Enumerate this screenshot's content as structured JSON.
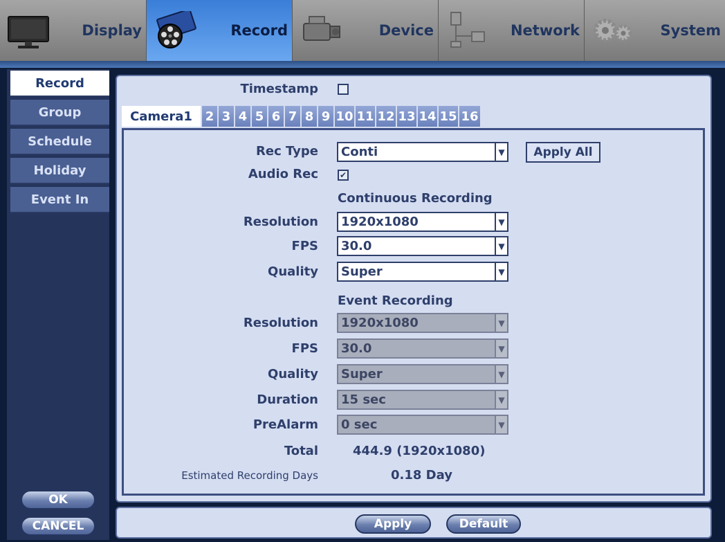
{
  "menu": {
    "tabs": [
      {
        "label": "Display",
        "icon": "monitor-icon"
      },
      {
        "label": "Record",
        "icon": "film-reel-icon"
      },
      {
        "label": "Device",
        "icon": "camera-icon"
      },
      {
        "label": "Network",
        "icon": "network-icon"
      },
      {
        "label": "System",
        "icon": "gear-icon"
      }
    ],
    "active": "Record"
  },
  "sidebar": {
    "items": [
      "Record",
      "Group",
      "Schedule",
      "Holiday",
      "Event In"
    ],
    "active": "Record",
    "ok_label": "OK",
    "cancel_label": "CANCEL"
  },
  "timestamp": {
    "label": "Timestamp",
    "checked": false
  },
  "camera_tabs": [
    "Camera1",
    "2",
    "3",
    "4",
    "5",
    "6",
    "7",
    "8",
    "9",
    "10",
    "11",
    "12",
    "13",
    "14",
    "15",
    "16"
  ],
  "camera": {
    "rec_type_label": "Rec Type",
    "rec_type_value": "Conti",
    "apply_all_label": "Apply All",
    "audio_rec_label": "Audio Rec",
    "audio_rec_checked": true,
    "continuous": {
      "header": "Continuous Recording",
      "resolution_label": "Resolution",
      "resolution_value": "1920x1080",
      "fps_label": "FPS",
      "fps_value": "30.0",
      "quality_label": "Quality",
      "quality_value": "Super"
    },
    "event": {
      "header": "Event Recording",
      "resolution_label": "Resolution",
      "resolution_value": "1920x1080",
      "fps_label": "FPS",
      "fps_value": "30.0",
      "quality_label": "Quality",
      "quality_value": "Super",
      "duration_label": "Duration",
      "duration_value": "15 sec",
      "prealarm_label": "PreAlarm",
      "prealarm_value": "0 sec"
    },
    "total_label": "Total",
    "total_value": "444.9 (1920x1080)",
    "est_days_label": "Estimated Recording Days",
    "est_days_value": "0.18 Day"
  },
  "footer": {
    "apply_label": "Apply",
    "default_label": "Default"
  },
  "colors": {
    "accent": "#3a7ed8",
    "panel": "#d5ddf1",
    "text": "#2e3f6b"
  }
}
